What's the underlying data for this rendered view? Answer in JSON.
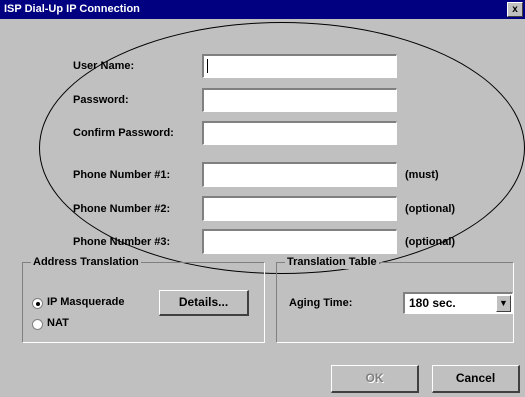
{
  "window": {
    "title": "ISP Dial-Up IP Connection",
    "close_symbol": "x"
  },
  "fields": [
    {
      "label": "User Name:",
      "value": "",
      "note": ""
    },
    {
      "label": "Password:",
      "value": "",
      "note": ""
    },
    {
      "label": "Confirm Password:",
      "value": "",
      "note": ""
    },
    {
      "label": "Phone Number #1:",
      "value": "",
      "note": "(must)"
    },
    {
      "label": "Phone Number #2:",
      "value": "",
      "note": "(optional)"
    },
    {
      "label": "Phone Number #3:",
      "value": "",
      "note": "(optional)"
    }
  ],
  "address_translation": {
    "legend": "Address Translation",
    "options": [
      {
        "label": "IP Masquerade",
        "selected": true
      },
      {
        "label": "NAT",
        "selected": false
      }
    ],
    "details_label": "Details..."
  },
  "translation_table": {
    "legend": "Translation Table",
    "aging_label": "Aging Time:",
    "aging_value": "180 sec.",
    "dropdown_icon": "down-arrow"
  },
  "buttons": {
    "ok_label": "OK",
    "cancel_label": "Cancel"
  }
}
